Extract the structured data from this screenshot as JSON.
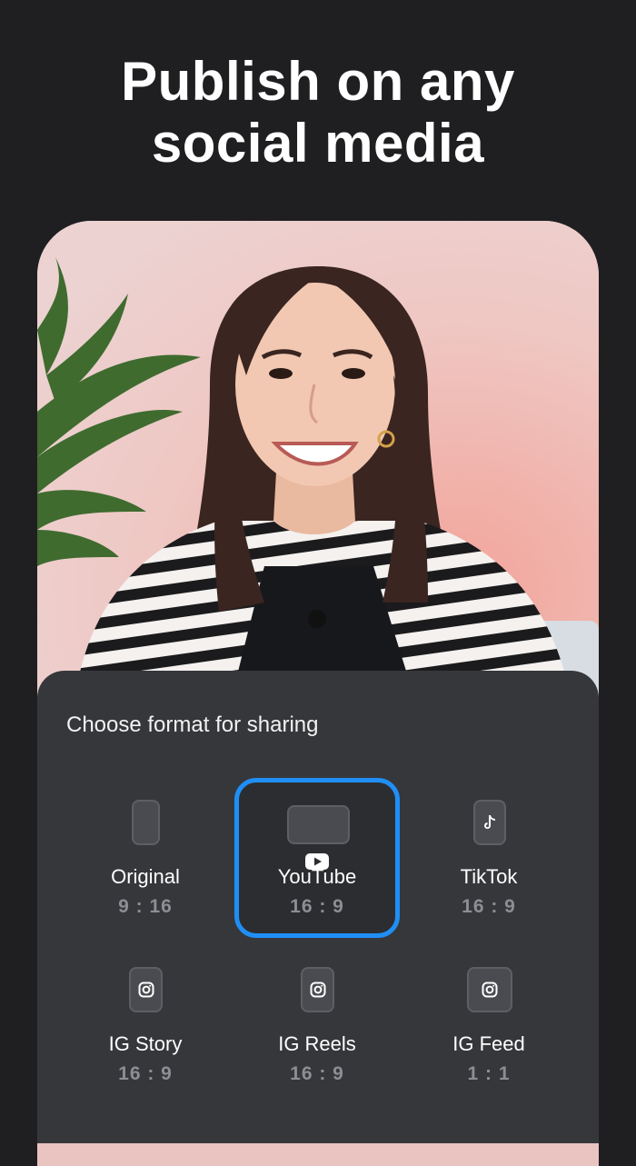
{
  "headline": {
    "line1": "Publish on any",
    "line2": "social media"
  },
  "sheet": {
    "title": "Choose format for sharing",
    "options": [
      {
        "label": "Original",
        "ratio": "9 : 16",
        "icon": "portrait-frame-icon",
        "selected": false
      },
      {
        "label": "YouTube",
        "ratio": "16 : 9",
        "icon": "youtube-icon",
        "selected": true
      },
      {
        "label": "TikTok",
        "ratio": "16 : 9",
        "icon": "tiktok-icon",
        "selected": false
      },
      {
        "label": "IG Story",
        "ratio": "16 : 9",
        "icon": "instagram-icon",
        "selected": false
      },
      {
        "label": "IG Reels",
        "ratio": "16 : 9",
        "icon": "instagram-icon",
        "selected": false
      },
      {
        "label": "IG Feed",
        "ratio": "1 : 1",
        "icon": "instagram-icon",
        "selected": false
      }
    ]
  },
  "colors": {
    "background": "#1f1f21",
    "sheet": "#36373b",
    "accent": "#1f8ff5",
    "muted": "#8d8e93"
  }
}
